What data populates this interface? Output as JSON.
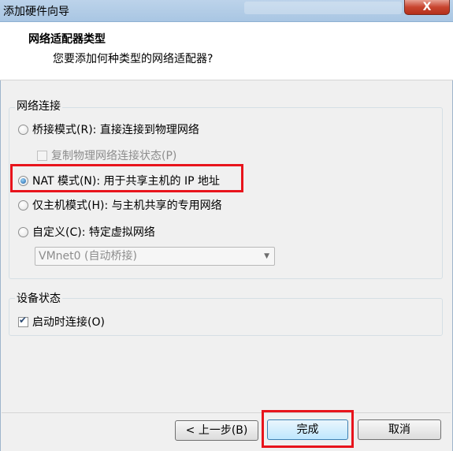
{
  "window": {
    "title": "添加硬件向导",
    "close_label": "X"
  },
  "header": {
    "title": "网络适配器类型",
    "subtitle": "您要添加何种类型的网络适配器?"
  },
  "network_group": {
    "legend": "网络连接",
    "bridged": {
      "label": "桥接模式(R): 直接连接到物理网络",
      "checked": false
    },
    "replicate": {
      "label": "复制物理网络连接状态(P)",
      "checked": false,
      "disabled": true
    },
    "nat": {
      "label": "NAT 模式(N): 用于共享主机的 IP 地址",
      "checked": true
    },
    "hostonly": {
      "label": "仅主机模式(H): 与主机共享的专用网络",
      "checked": false
    },
    "custom": {
      "label": "自定义(C): 特定虚拟网络",
      "checked": false
    },
    "vmnet_select": {
      "value": "VMnet0 (自动桥接)"
    }
  },
  "device_group": {
    "legend": "设备状态",
    "connect_on_start": {
      "label": "启动时连接(O)",
      "checked": true
    }
  },
  "buttons": {
    "back": "< 上一步(B)",
    "finish": "完成",
    "cancel": "取消"
  },
  "colors": {
    "highlight": "#e8141c",
    "default_button": "#bee6fd"
  }
}
